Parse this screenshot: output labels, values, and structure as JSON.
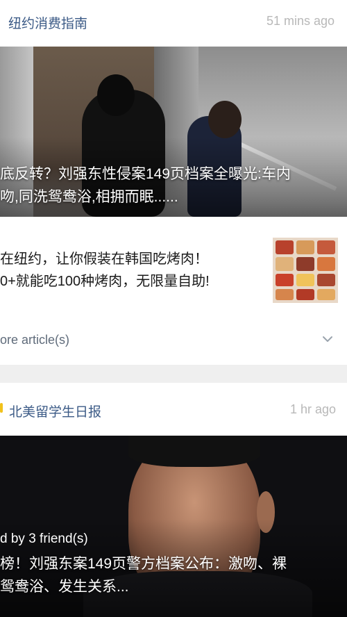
{
  "card1": {
    "source": "纽约消费指南",
    "time": "51 mins ago",
    "hero_caption": "底反转？刘强东性侵案149页档案全曝光:车内\n吻,同洗鸳鸯浴,相拥而眠......",
    "article2_title": "在纽约，让你假装在韩国吃烤肉！\n0+就能吃100种烤肉，无限量自助!",
    "more_label": "ore article(s)"
  },
  "card2": {
    "source": "北美留学生日报",
    "time": "1 hr ago",
    "shared_by": "d by 3 friend(s)",
    "hero_caption": "榜！刘强东案149页警方档案公布：激吻、裸\n鸳鸯浴、发生关系..."
  },
  "colors": {
    "source_blue": "#3b5a86",
    "time_gray": "#b8b8b8",
    "accent_yellow": "#f1c21b"
  },
  "icons": {
    "expand": "chevron-down-icon"
  }
}
